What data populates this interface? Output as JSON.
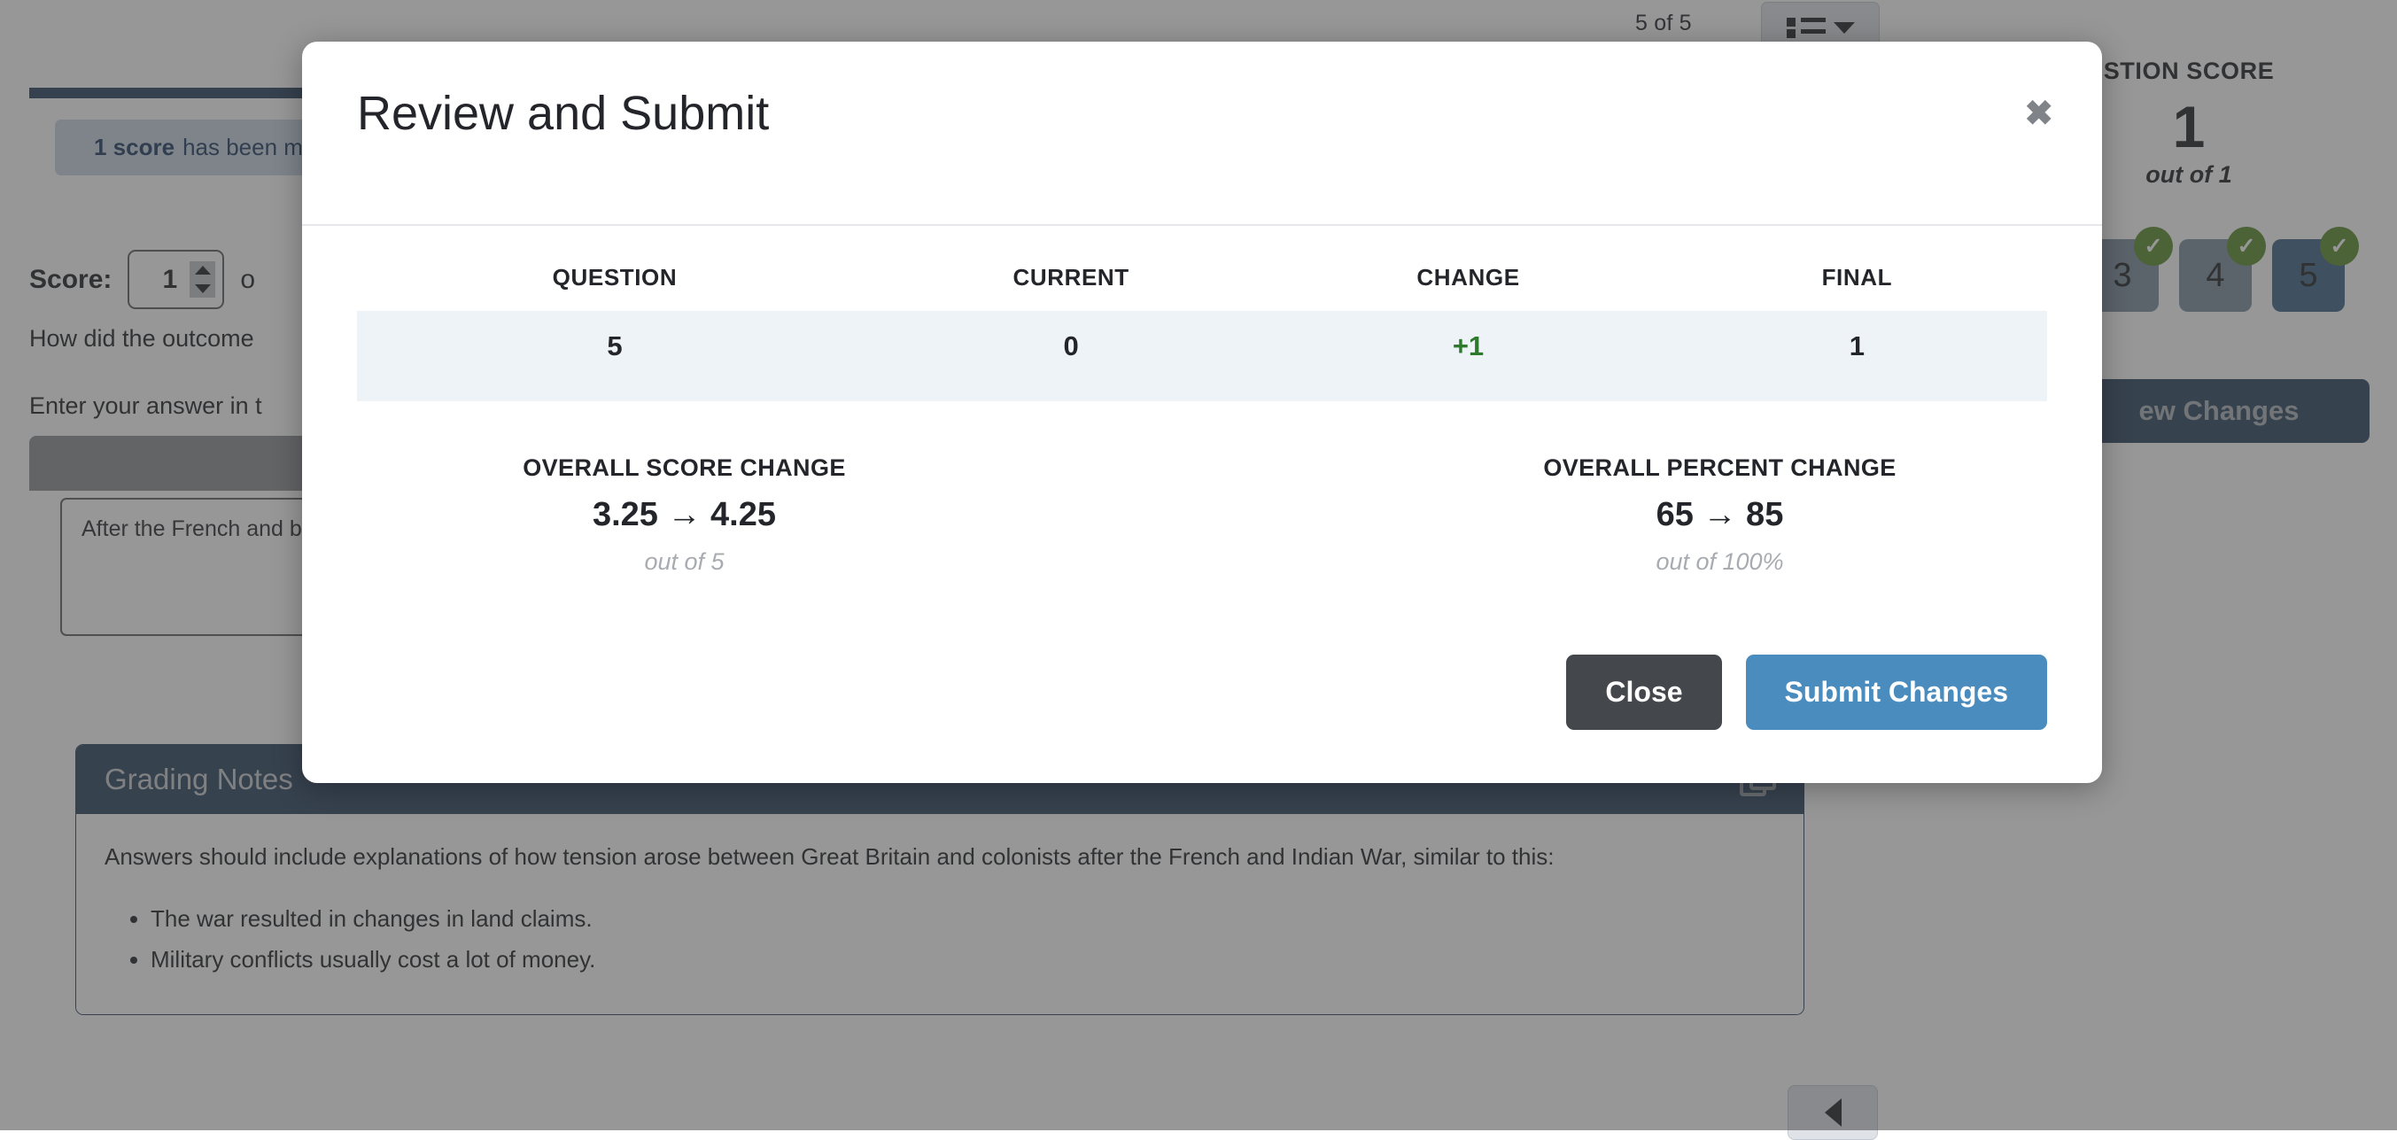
{
  "background": {
    "top_counter": "5 of 5",
    "list_dropdown_icon": "list-dropdown-icon",
    "alert": {
      "bold": "1 score",
      "text": "has been m"
    },
    "score_label": "Score:",
    "score_value": "1",
    "score_outof": "o",
    "question_prompt": "How did the outcome",
    "question_instruction": "Enter your answer in t",
    "answer_text": "After the French and\nbecause they didn't\ncolonists even angr\nprotested a lot, like\nown country, and th",
    "grading_notes": {
      "title": "Grading Notes",
      "copy_icon": "copy-icon",
      "intro": "Answers should include explanations of how tension arose between Great Britain and colonists after the French and Indian War, similar to this:",
      "bullets": [
        "The war resulted in changes in land claims.",
        "Military conflicts usually cost a lot of money."
      ]
    },
    "prev_button_icon": "caret-left-icon"
  },
  "right_panel": {
    "question_score_title": "STION SCORE",
    "question_score_value": "1",
    "question_score_outof": "out of 1",
    "question_nav": [
      {
        "label": "",
        "state": "amber",
        "active": false,
        "check": "✓"
      },
      {
        "label": "3",
        "state": "green",
        "active": false,
        "check": "✓"
      },
      {
        "label": "4",
        "state": "green",
        "active": false,
        "check": "✓"
      },
      {
        "label": "5",
        "state": "green",
        "active": true,
        "check": "✓"
      }
    ],
    "review_changes_label": "ew Changes"
  },
  "modal": {
    "title": "Review and Submit",
    "close_icon": "✖",
    "table": {
      "headers": [
        "QUESTION",
        "CURRENT",
        "CHANGE",
        "FINAL"
      ],
      "rows": [
        {
          "question": "5",
          "current": "0",
          "change": "+1",
          "final": "1"
        }
      ]
    },
    "summary": {
      "score_change": {
        "label": "OVERALL SCORE CHANGE",
        "value": "3.25 → 4.25",
        "sub": "out of 5"
      },
      "percent_change": {
        "label": "OVERALL PERCENT CHANGE",
        "value": "65 → 85",
        "sub": "out of 100%"
      }
    },
    "buttons": {
      "close": "Close",
      "submit": "Submit Changes"
    }
  },
  "colors": {
    "accent_blue": "#4a8cbe",
    "navy": "#2a4460",
    "close_gray": "#44474c",
    "row_highlight": "#eef3f8",
    "change_positive": "#2d7a2d",
    "check_green": "#5a8a2c"
  }
}
